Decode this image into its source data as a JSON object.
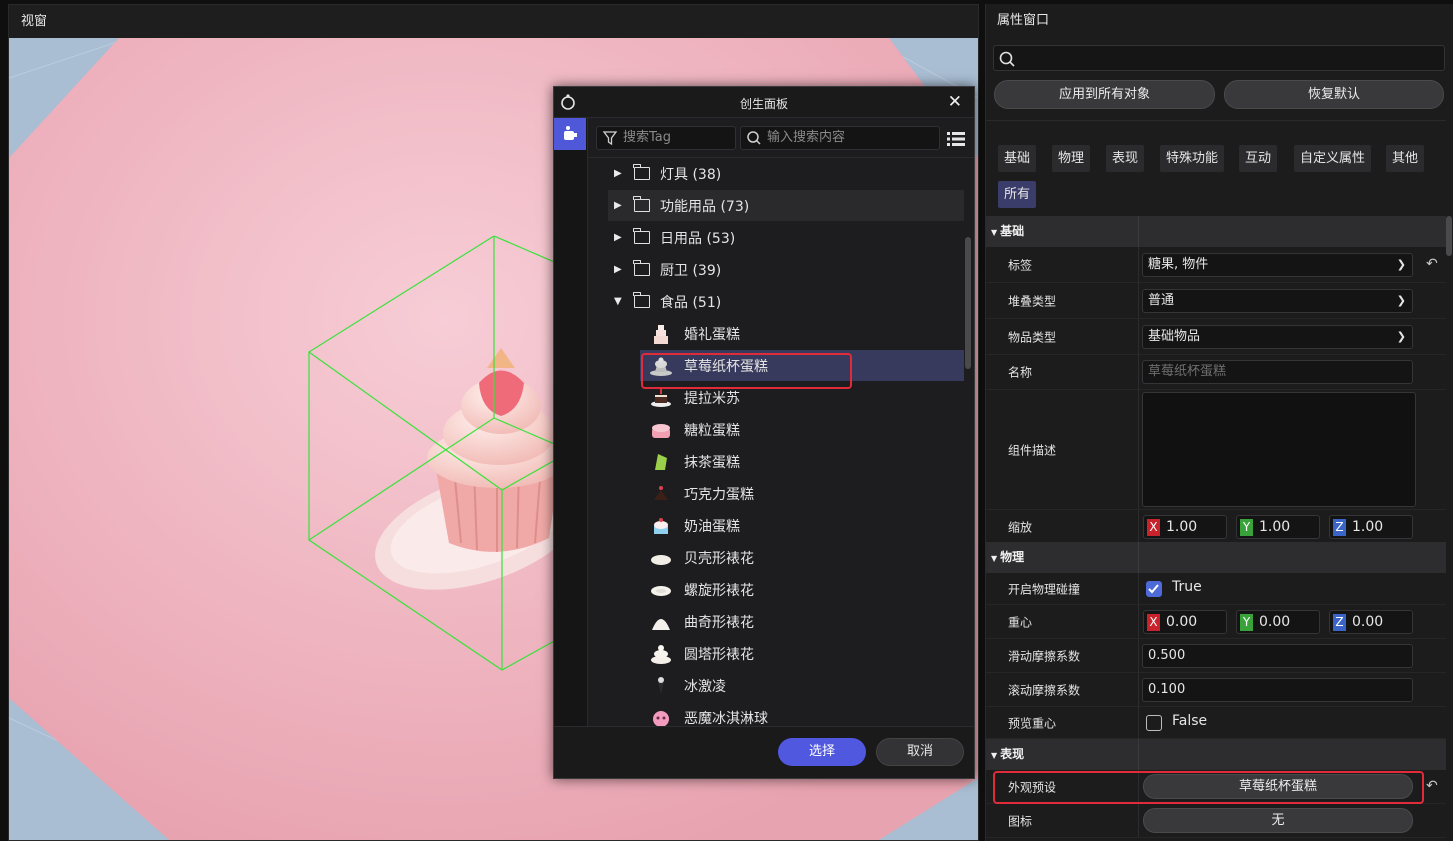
{
  "viewport": {
    "title": "视窗"
  },
  "dialog": {
    "title": "创生面板",
    "tag_search_placeholder": "搜索Tag",
    "search_placeholder": "输入搜索内容",
    "folders": [
      {
        "label": "灯具 (38)",
        "expanded": false
      },
      {
        "label": "功能用品 (73)",
        "expanded": false
      },
      {
        "label": "日用品 (53)",
        "expanded": false
      },
      {
        "label": "厨卫 (39)",
        "expanded": false
      },
      {
        "label": "食品 (51)",
        "expanded": true
      }
    ],
    "items": [
      {
        "label": "婚礼蛋糕",
        "icon": "wedding-cake-icon"
      },
      {
        "label": "草莓纸杯蛋糕",
        "icon": "cupcake-icon",
        "selected": true
      },
      {
        "label": "提拉米苏",
        "icon": "tiramisu-icon"
      },
      {
        "label": "糖粒蛋糕",
        "icon": "sprinkle-cake-icon"
      },
      {
        "label": "抹茶蛋糕",
        "icon": "matcha-cake-icon"
      },
      {
        "label": "巧克力蛋糕",
        "icon": "chocolate-cake-icon"
      },
      {
        "label": "奶油蛋糕",
        "icon": "cream-cake-icon"
      },
      {
        "label": "贝壳形裱花",
        "icon": "shell-icing-icon"
      },
      {
        "label": "螺旋形裱花",
        "icon": "spiral-icing-icon"
      },
      {
        "label": "曲奇形裱花",
        "icon": "cookie-icing-icon"
      },
      {
        "label": "圆塔形裱花",
        "icon": "tower-icing-icon"
      },
      {
        "label": "冰激凌",
        "icon": "ice-cream-icon"
      },
      {
        "label": "恶魔冰淇淋球",
        "icon": "devil-ice-cream-icon"
      }
    ],
    "select_label": "选择",
    "cancel_label": "取消"
  },
  "props": {
    "title": "属性窗口",
    "apply_all_label": "应用到所有对象",
    "reset_label": "恢复默认",
    "categories": [
      "基础",
      "物理",
      "表现",
      "特殊功能",
      "互动",
      "自定义属性",
      "其他",
      "所有"
    ],
    "active_category": "所有",
    "sections": {
      "basic": "基础",
      "physics": "物理",
      "appearance": "表现"
    },
    "basic": {
      "tag_label": "标签",
      "tag_value": "糖果, 物件",
      "stack_label": "堆叠类型",
      "stack_value": "普通",
      "item_type_label": "物品类型",
      "item_type_value": "基础物品",
      "name_label": "名称",
      "name_placeholder": "草莓纸杯蛋糕",
      "desc_label": "组件描述",
      "scale_label": "缩放",
      "scale_x": "1.00",
      "scale_y": "1.00",
      "scale_z": "1.00"
    },
    "physics": {
      "collision_label": "开启物理碰撞",
      "collision_value": "True",
      "center_label": "重心",
      "center_x": "0.00",
      "center_y": "0.00",
      "center_z": "0.00",
      "slide_label": "滑动摩擦系数",
      "slide_value": "0.500",
      "roll_label": "滚动摩擦系数",
      "roll_value": "0.100",
      "preview_label": "预览重心",
      "preview_value": "False"
    },
    "appearance": {
      "preset_label": "外观预设",
      "preset_value": "草莓纸杯蛋糕",
      "icon_label": "图标",
      "icon_value": "无"
    },
    "axis": {
      "x": "X",
      "y": "Y",
      "z": "Z"
    },
    "colors": {
      "x_axis": "#c8232c",
      "y_axis": "#3aa23a",
      "z_axis": "#3a64c8",
      "accent": "#5058e0",
      "highlight": "#e02b3b"
    }
  }
}
